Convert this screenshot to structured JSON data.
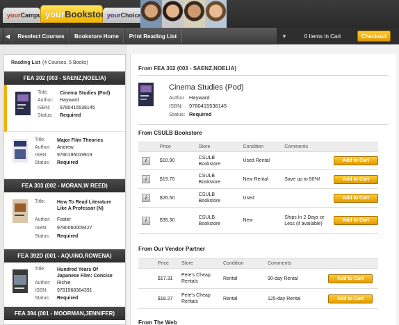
{
  "header": {
    "tabs": [
      {
        "prefix": "your",
        "name": "Campus"
      },
      {
        "prefix": "your",
        "name": "Bookstore"
      },
      {
        "prefix": "your",
        "name": "Choices"
      }
    ]
  },
  "toolbar": {
    "reselect": "Reselect Courses",
    "home": "Bookstore Home",
    "print": "Print Reading List",
    "cart": "0 Items In Cart",
    "checkout": "Checkout"
  },
  "left": {
    "title": "Reading List",
    "summary": "(4 Courses, 5 Books)",
    "labels": {
      "title": "Title:",
      "author": "Author:",
      "isbn": "ISBN:",
      "status": "Status:"
    },
    "courses": [
      {
        "name": "FEA 302 (003 - SAENZ,NOELIA)",
        "books": [
          {
            "title": "Cinema Studies (Pod)",
            "author": "Hayward",
            "isbn": "9780415538145",
            "status": "Required"
          },
          {
            "title": "Major Film Theories",
            "author": "Andrew",
            "isbn": "9780195019919",
            "status": "Required"
          }
        ]
      },
      {
        "name": "FEA 303 (002 - MORAN,W REED)",
        "books": [
          {
            "title": "How To Read Literature Like A Professor (N)",
            "author": "Foster",
            "isbn": "9780060009427",
            "status": "Required"
          }
        ]
      },
      {
        "name": "FEA 392D (001 - AQUINO,ROWENA)",
        "books": [
          {
            "title": "Hundred Years Of Japanese Film: Concise",
            "author": "Richie",
            "isbn": "9781568364391",
            "status": "Required"
          }
        ]
      },
      {
        "name": "FEA 394 (001 - MOORMAN,JENNIFER)",
        "books": []
      }
    ]
  },
  "detail": {
    "from": "From FEA 302 (003 - SAENZ,NOELIA)",
    "title": "Cinema Studies (Pod)",
    "author_label": "Author",
    "author": "Hayward",
    "isbn_label": "ISBN:",
    "isbn": "9780415538145",
    "status_label": "Status:",
    "status": "Required",
    "store_section": "From CSULB Bookstore",
    "vendor_section": "From Our Vendor Partner",
    "web_section": "From The Web",
    "store_headers": [
      "",
      "Price",
      "Store",
      "Condition",
      "Comments",
      ""
    ],
    "store_rows": [
      {
        "price": "$10.90",
        "store": "CSULB Bookstore",
        "condition": "Used Rental",
        "comments": "",
        "button": "Add to Cart"
      },
      {
        "price": "$19.70",
        "store": "CSULB Bookstore",
        "condition": "New Rental",
        "comments": "Save up to 50%!",
        "button": "Add to Cart"
      },
      {
        "price": "$26.50",
        "store": "CSULB Bookstore",
        "condition": "Used",
        "comments": "",
        "button": "Add to Cart"
      },
      {
        "price": "$35.30",
        "store": "CSULB Bookstore",
        "condition": "New",
        "comments": "Ships In 2 Days or Less (if available)",
        "button": "Add to Cart"
      }
    ],
    "vendor_headers": [
      "Price",
      "Store",
      "Condition",
      "Comments",
      ""
    ],
    "vendor_rows": [
      {
        "price": "$17.31",
        "store": "Pete's Cheap Rentals",
        "condition": "Rental",
        "comments": "90-day Rental",
        "button": "Add to Cart"
      },
      {
        "price": "$18.27",
        "store": "Pete's Cheap Rentals",
        "condition": "Rental",
        "comments": "125-day Rental",
        "button": "Add to Cart"
      }
    ]
  }
}
